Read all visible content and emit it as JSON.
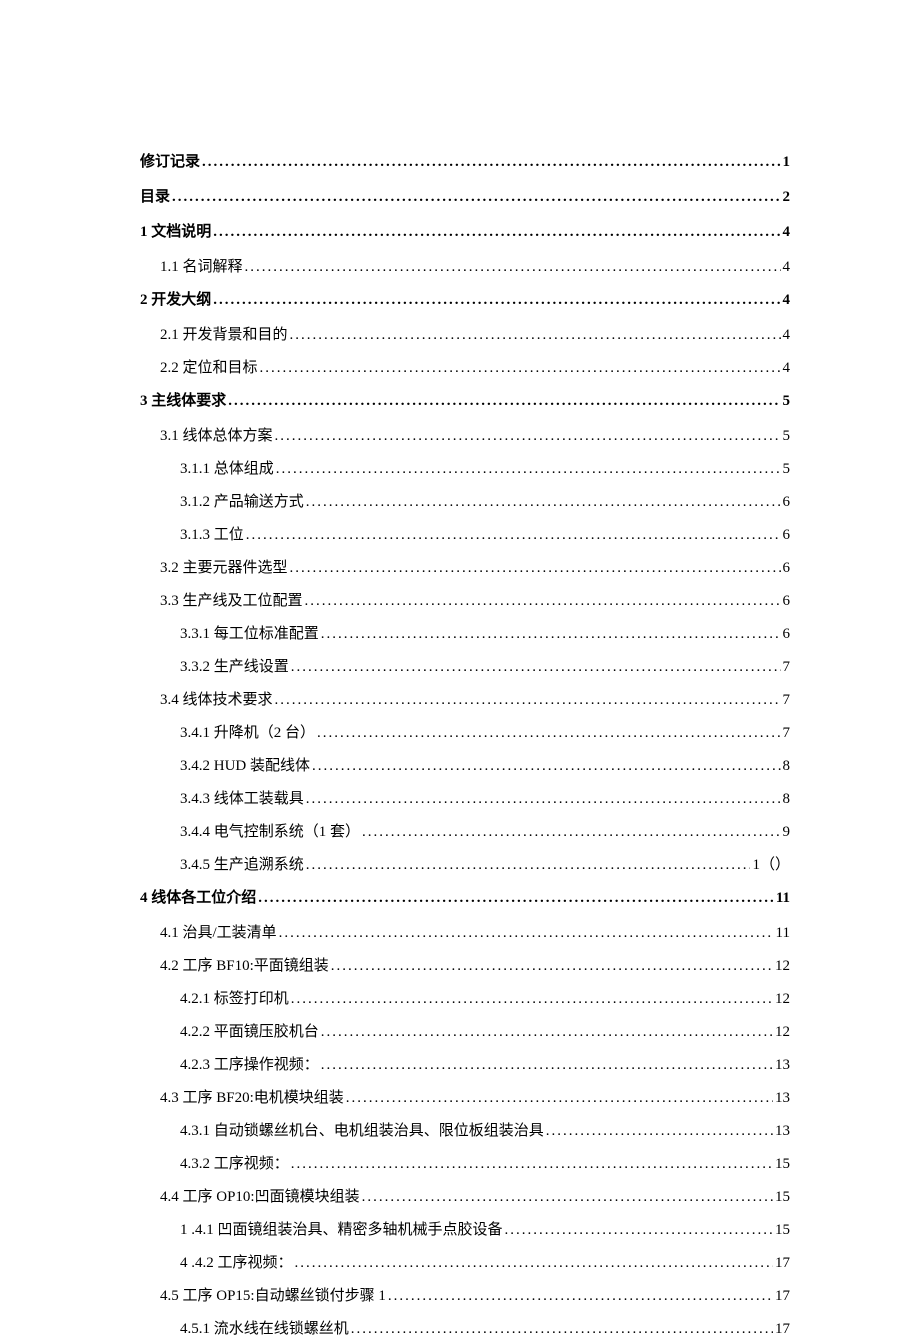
{
  "toc": [
    {
      "label": "修订记录",
      "page": "1",
      "level": 1,
      "bold": true
    },
    {
      "label": "目录",
      "page": "2",
      "level": 1,
      "bold": true
    },
    {
      "label": "1 文档说明",
      "page": "4",
      "level": 1,
      "bold": true
    },
    {
      "label": "1.1 名词解释",
      "page": "4",
      "level": 2,
      "bold": false
    },
    {
      "label": "2 开发大纲",
      "page": "4",
      "level": 1,
      "bold": true
    },
    {
      "label": "2.1 开发背景和目的",
      "page": "4",
      "level": 2,
      "bold": false
    },
    {
      "label": "2.2 定位和目标",
      "page": "4",
      "level": 2,
      "bold": false
    },
    {
      "label": "3 主线体要求",
      "page": "5",
      "level": 1,
      "bold": true
    },
    {
      "label": "3.1 线体总体方案",
      "page": "5",
      "level": 2,
      "bold": false
    },
    {
      "label": "3.1.1 总体组成",
      "page": "5",
      "level": 3,
      "bold": false
    },
    {
      "label": "3.1.2 产品输送方式",
      "page": "6",
      "level": 3,
      "bold": false
    },
    {
      "label": "3.1.3 工位",
      "page": "6",
      "level": 3,
      "bold": false
    },
    {
      "label": "3.2 主要元器件选型",
      "page": "6",
      "level": 2,
      "bold": false
    },
    {
      "label": "3.3 生产线及工位配置",
      "page": "6",
      "level": 2,
      "bold": false
    },
    {
      "label": "3.3.1 每工位标准配置",
      "page": "6",
      "level": 3,
      "bold": false
    },
    {
      "label": "3.3.2 生产线设置",
      "page": "7",
      "level": 3,
      "bold": false
    },
    {
      "label": "3.4 线体技术要求",
      "page": "7",
      "level": 2,
      "bold": false
    },
    {
      "label": "3.4.1 升降机（2 台）",
      "page": "7",
      "level": 3,
      "bold": false
    },
    {
      "label": "3.4.2 HUD 装配线体",
      "page": "8",
      "level": 3,
      "bold": false
    },
    {
      "label": "3.4.3 线体工装载具",
      "page": "8",
      "level": 3,
      "bold": false
    },
    {
      "label": "3.4.4 电气控制系统（1 套）",
      "page": "9",
      "level": 3,
      "bold": false
    },
    {
      "label": "3.4.5 生产追溯系统",
      "page": "1（）",
      "level": 3,
      "bold": false
    },
    {
      "label": "4 线体各工位介绍",
      "page": "11",
      "level": 1,
      "bold": true
    },
    {
      "label": "4.1 治具/工装清单",
      "page": "11",
      "level": 2,
      "bold": false
    },
    {
      "label": "4.2 工序 BF10:平面镜组装",
      "page": "12",
      "level": 2,
      "bold": false
    },
    {
      "label": "4.2.1 标签打印机",
      "page": "12",
      "level": 3,
      "bold": false
    },
    {
      "label": "4.2.2 平面镜压胶机台",
      "page": "12",
      "level": 3,
      "bold": false
    },
    {
      "label": "4.2.3 工序操作视频：",
      "page": "13",
      "level": 3,
      "bold": false
    },
    {
      "label": "4.3 工序 BF20:电机模块组装",
      "page": "13",
      "level": 2,
      "bold": false
    },
    {
      "label": "4.3.1 自动锁螺丝机台、电机组装治具、限位板组装治具",
      "page": "13",
      "level": 3,
      "bold": false
    },
    {
      "label": "4.3.2 工序视频：",
      "page": "15",
      "level": 3,
      "bold": false
    },
    {
      "label": "4.4 工序 OP10:凹面镜模块组装",
      "page": "15",
      "level": 2,
      "bold": false
    },
    {
      "label": "1  .4.1 凹面镜组装治具、精密多轴机械手点胶设备",
      "page": "15",
      "level": 3,
      "bold": false
    },
    {
      "label": "4  .4.2 工序视频：",
      "page": "17",
      "level": 3,
      "bold": false
    },
    {
      "label": "4.5 工序 OP15:自动螺丝锁付步骤 1",
      "page": "17",
      "level": 2,
      "bold": false
    },
    {
      "label": "4.5.1 流水线在线锁螺丝机",
      "page": "17",
      "level": 3,
      "bold": false
    }
  ]
}
